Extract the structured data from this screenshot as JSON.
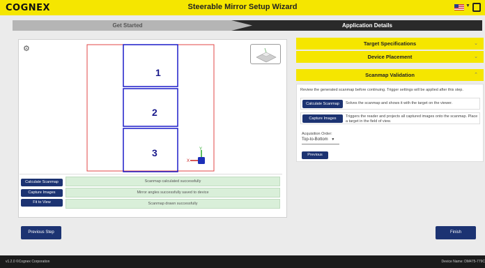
{
  "header": {
    "logo": "COGNEX",
    "title": "Steerable Mirror Setup Wizard",
    "flag_icon": "us-flag-icon",
    "exit_icon": "exit-icon"
  },
  "steps": [
    "Get Started",
    "Application Details"
  ],
  "viewer": {
    "settings_icon": "gear-icon",
    "tiles": [
      "1",
      "2",
      "3"
    ],
    "axis_labels": {
      "y": "Y",
      "x": "X"
    },
    "buttons": {
      "calculate": "Calculate Scanmap",
      "capture": "Capture Images",
      "fit": "Fit to View"
    },
    "status_messages": [
      "Scanmap calculated successfully",
      "Mirror angles successfully saved to device",
      "Scanmap drawn successfully"
    ]
  },
  "accordion": {
    "target_specs": "Target Specifications",
    "device_placement": "Device Placement",
    "scanmap_validation": "Scanmap Validation",
    "chevron_down": "⌄",
    "chevron_up": "⌃"
  },
  "scanmap_panel": {
    "intro": "Review the generated scanmap before continuing. Trigger settings will be applied after this step.",
    "calculate_button": "Calculate Scanmap",
    "calculate_desc": "Solves the scanmap and shows it with the target on the viewer.",
    "capture_button": "Capture Images",
    "capture_desc": "Triggers the reader and projects all captured images onto the scanmap. Place a target in the field of view.",
    "acq_label": "Acquisition Order:",
    "acq_value": "Top-to-Bottom",
    "previous": "Previous"
  },
  "nav": {
    "previous_step": "Previous Step",
    "finish": "Finish"
  },
  "footer": {
    "version": "v1.2.0 ©Cognex Corporation",
    "device": "Device Name: DM475-779C"
  },
  "colors": {
    "accent": "#f5e600",
    "button": "#1c3372",
    "status_bg": "#d9efd9",
    "tile_border": "#1a1ac8",
    "frame": "#e04545"
  }
}
